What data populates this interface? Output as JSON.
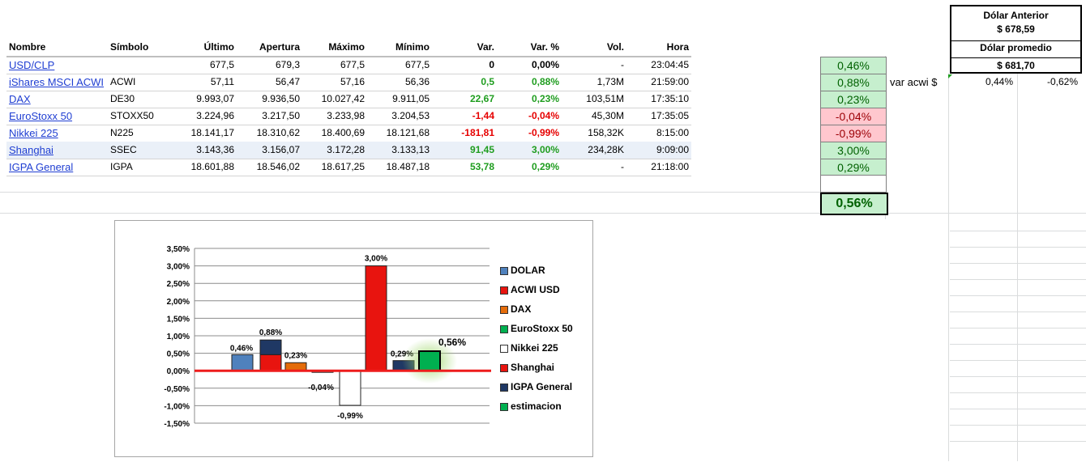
{
  "market": {
    "headers": [
      "Nombre",
      "Símbolo",
      "Último",
      "Apertura",
      "Máximo",
      "Mínimo",
      "Var.",
      "Var. %",
      "Vol.",
      "Hora"
    ],
    "rows": [
      {
        "name": "USD/CLP",
        "symbol": "",
        "last": "677,5",
        "open": "679,3",
        "high": "677,5",
        "low": "677,5",
        "var": "0",
        "var_pct": "0,00%",
        "vol": "-",
        "time": "23:04:45",
        "dir": "zero"
      },
      {
        "name": "iShares MSCI ACWI",
        "symbol": "ACWI",
        "last": "57,11",
        "open": "56,47",
        "high": "57,16",
        "low": "56,36",
        "var": "0,5",
        "var_pct": "0,88%",
        "vol": "1,73M",
        "time": "21:59:00",
        "dir": "pos"
      },
      {
        "name": "DAX",
        "symbol": "DE30",
        "last": "9.993,07",
        "open": "9.936,50",
        "high": "10.027,42",
        "low": "9.911,05",
        "var": "22,67",
        "var_pct": "0,23%",
        "vol": "103,51M",
        "time": "17:35:10",
        "dir": "pos"
      },
      {
        "name": "EuroStoxx 50",
        "symbol": "STOXX50",
        "last": "3.224,96",
        "open": "3.217,50",
        "high": "3.233,98",
        "low": "3.204,53",
        "var": "-1,44",
        "var_pct": "-0,04%",
        "vol": "45,30M",
        "time": "17:35:05",
        "dir": "neg"
      },
      {
        "name": "Nikkei 225",
        "symbol": "N225",
        "last": "18.141,17",
        "open": "18.310,62",
        "high": "18.400,69",
        "low": "18.121,68",
        "var": "-181,81",
        "var_pct": "-0,99%",
        "vol": "158,32K",
        "time": "8:15:00",
        "dir": "neg"
      },
      {
        "name": "Shanghai",
        "symbol": "SSEC",
        "last": "3.143,36",
        "open": "3.156,07",
        "high": "3.172,28",
        "low": "3.133,13",
        "var": "91,45",
        "var_pct": "3,00%",
        "vol": "234,28K",
        "time": "9:09:00",
        "dir": "pos"
      },
      {
        "name": "IGPA General",
        "symbol": "IGPA",
        "last": "18.601,88",
        "open": "18.546,02",
        "high": "18.617,25",
        "low": "18.487,18",
        "var": "53,78",
        "var_pct": "0,29%",
        "vol": "-",
        "time": "21:18:00",
        "dir": "pos"
      }
    ]
  },
  "var_boxes": [
    {
      "value": "0,46%",
      "tone": "green"
    },
    {
      "value": "0,88%",
      "tone": "green"
    },
    {
      "value": "0,23%",
      "tone": "green"
    },
    {
      "value": "-0,04%",
      "tone": "red"
    },
    {
      "value": "-0,99%",
      "tone": "red"
    },
    {
      "value": "3,00%",
      "tone": "green"
    },
    {
      "value": "0,29%",
      "tone": "green"
    }
  ],
  "estimate_box": "0,56%",
  "acwi_var": {
    "label": "var acwi $",
    "pct1": "0,44%",
    "pct2": "-0,62%"
  },
  "dollar": {
    "prev_label": "Dólar Anterior",
    "prev_value": "$ 678,59",
    "avg_label": "Dólar promedio",
    "avg_value": "$ 681,70"
  },
  "colors": {
    "green_fill": "#c6efce",
    "green_text": "#006100",
    "red_fill": "#ffc7ce",
    "red_text": "#9c0006",
    "link": "#1f3ed2"
  },
  "chart_data": {
    "type": "bar",
    "title": "",
    "ylim": [
      -1.5,
      3.5
    ],
    "yticks": [
      "3,50%",
      "3,00%",
      "2,50%",
      "2,00%",
      "1,50%",
      "1,00%",
      "0,50%",
      "0,00%",
      "-0,50%",
      "-1,00%",
      "-1,50%"
    ],
    "series": [
      {
        "name": "DOLAR",
        "value": 0.46,
        "label": "0,46%",
        "color": "#4f81bd"
      },
      {
        "name": "ACWI USD",
        "value": 0.88,
        "label": "0,88%",
        "color": "#e8140f",
        "top_color": "#1f3864"
      },
      {
        "name": "DAX",
        "value": 0.23,
        "label": "0,23%",
        "color": "#e46c0a"
      },
      {
        "name": "EuroStoxx 50",
        "value": -0.04,
        "label": "-0,04%",
        "color": "#bfbfbf"
      },
      {
        "name": "Nikkei 225",
        "value": -0.99,
        "label": "-0,99%",
        "color": "#ffffff"
      },
      {
        "name": "Shanghai",
        "value": 3.0,
        "label": "3,00%",
        "color": "#e8140f"
      },
      {
        "name": "IGPA General",
        "value": 0.29,
        "label": "0,29%",
        "color": "#1f3864"
      },
      {
        "name": "estimacion",
        "value": 0.56,
        "label": "0,56%",
        "color": "#00b050"
      }
    ],
    "legend": [
      "DOLAR",
      "ACWI USD",
      "DAX",
      "EuroStoxx 50",
      "Nikkei 225",
      "Shanghai",
      "IGPA General",
      "estimacion"
    ],
    "legend_colors": [
      "#4f81bd",
      "#e8140f",
      "#e46c0a",
      "#00b050",
      "#ffffff",
      "#e8140f",
      "#1f3864",
      "#00b050"
    ],
    "legend_placement": "right"
  }
}
